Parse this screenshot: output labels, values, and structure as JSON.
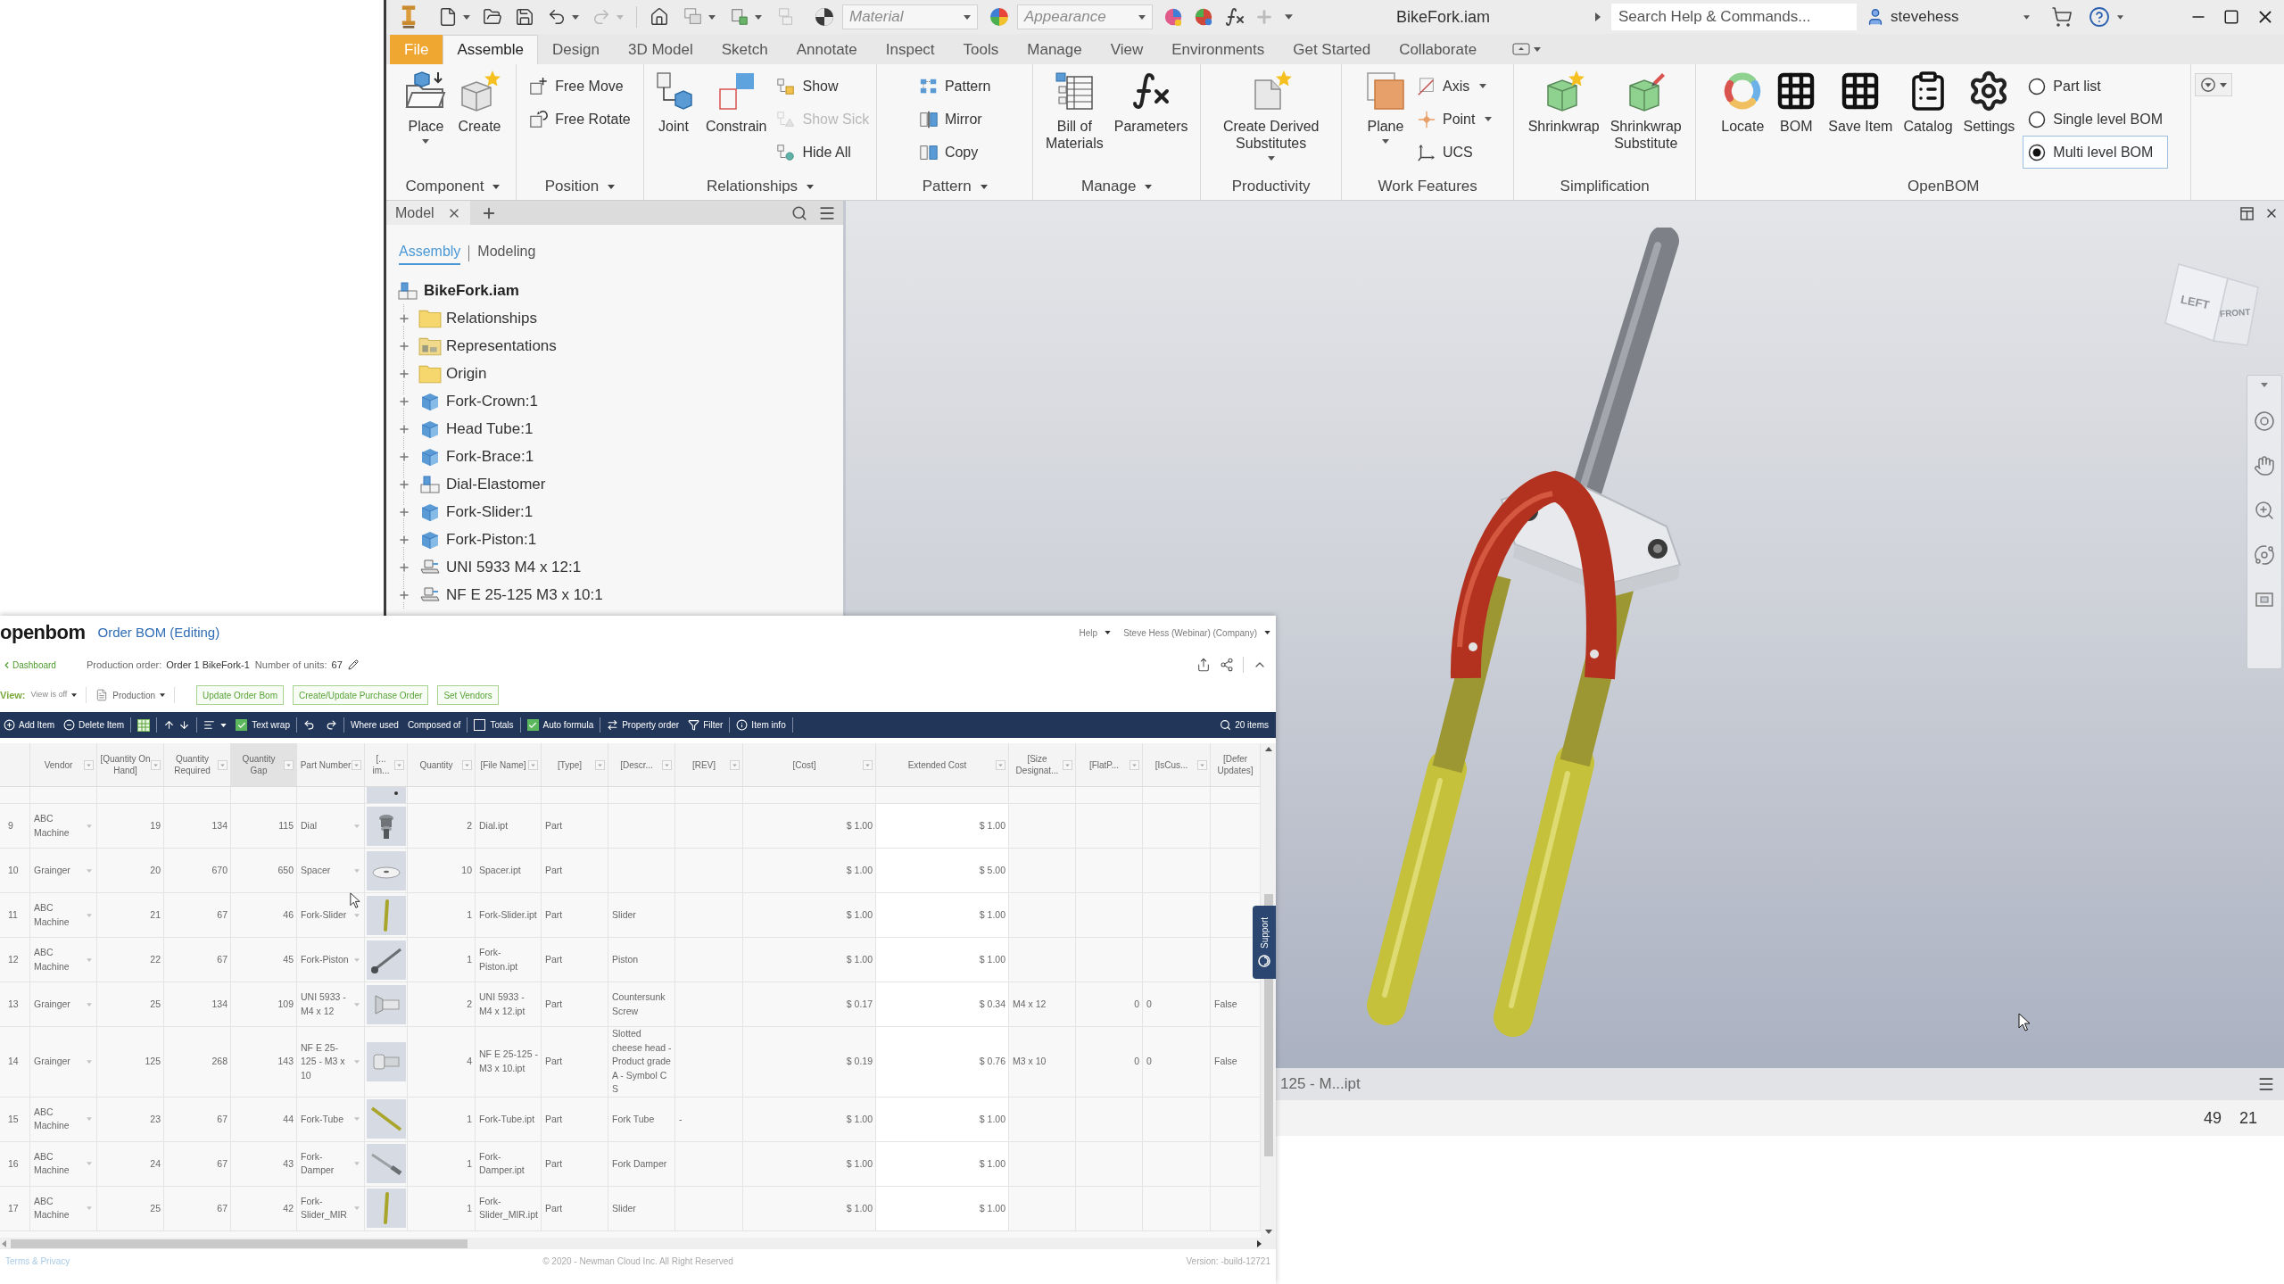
{
  "inventor": {
    "title_bar": {
      "material": "Material",
      "appearance": "Appearance",
      "document": "BikeFork.iam",
      "search": {
        "placeholder": "Search Help & Commands..."
      },
      "user": "stevehess"
    },
    "tabs": [
      {
        "label": "File",
        "kind": "file",
        "selected": false
      },
      {
        "label": "Assemble",
        "kind": "tab",
        "selected": true
      },
      {
        "label": "Design",
        "kind": "tab",
        "selected": false
      },
      {
        "label": "3D Model",
        "kind": "tab",
        "selected": false
      },
      {
        "label": "Sketch",
        "kind": "tab",
        "selected": false
      },
      {
        "label": "Annotate",
        "kind": "tab",
        "selected": false
      },
      {
        "label": "Inspect",
        "kind": "tab",
        "selected": false
      },
      {
        "label": "Tools",
        "kind": "tab",
        "selected": false
      },
      {
        "label": "Manage",
        "kind": "tab",
        "selected": false
      },
      {
        "label": "View",
        "kind": "tab",
        "selected": false
      },
      {
        "label": "Environments",
        "kind": "tab",
        "selected": false
      },
      {
        "label": "Get Started",
        "kind": "tab",
        "selected": false
      },
      {
        "label": "Collaborate",
        "kind": "tab",
        "selected": false
      }
    ],
    "ribbon": [
      {
        "label": "Component",
        "menu": true,
        "tools": [
          {
            "kind": "large",
            "label": "Place",
            "menu": true,
            "disabled": false
          },
          {
            "kind": "large",
            "label": "Create",
            "menu": false,
            "disabled": false
          }
        ]
      },
      {
        "label": "Position",
        "menu": true,
        "tools": [
          {
            "kind": "small",
            "label": "Free Move",
            "menu": false,
            "disabled": false
          },
          {
            "kind": "small",
            "label": "Free Rotate",
            "menu": false,
            "disabled": false
          }
        ]
      },
      {
        "label": "Relationships",
        "menu": true,
        "tools": [
          {
            "kind": "large",
            "label": "Joint",
            "menu": false,
            "disabled": false
          },
          {
            "kind": "large",
            "label": "Constrain",
            "menu": false,
            "disabled": false
          },
          {
            "kind": "small",
            "label": "Show",
            "menu": false,
            "disabled": false
          },
          {
            "kind": "small",
            "label": "Show Sick",
            "menu": false,
            "disabled": true
          },
          {
            "kind": "small",
            "label": "Hide All",
            "menu": false,
            "disabled": false
          }
        ]
      },
      {
        "label": "Pattern",
        "menu": true,
        "tools": [
          {
            "kind": "small",
            "label": "Pattern",
            "menu": false,
            "disabled": false
          },
          {
            "kind": "small",
            "label": "Mirror",
            "menu": false,
            "disabled": false
          },
          {
            "kind": "small",
            "label": "Copy",
            "menu": false,
            "disabled": false
          }
        ]
      },
      {
        "label": "Manage",
        "menu": true,
        "tools": [
          {
            "kind": "large",
            "label": "Bill of\nMaterials",
            "menu": false,
            "disabled": false
          },
          {
            "kind": "large",
            "label": "Parameters",
            "menu": false,
            "disabled": false
          }
        ]
      },
      {
        "label": "Productivity",
        "menu": false,
        "tools": [
          {
            "kind": "large",
            "label": "Create Derived\nSubstitutes",
            "menu": true,
            "disabled": false
          }
        ]
      },
      {
        "label": "Work Features",
        "menu": false,
        "tools": [
          {
            "kind": "large",
            "label": "Plane",
            "menu": true,
            "disabled": false
          },
          {
            "kind": "small",
            "label": "Axis",
            "menu": true,
            "disabled": false
          },
          {
            "kind": "small",
            "label": "Point",
            "menu": true,
            "disabled": false
          },
          {
            "kind": "small",
            "label": "UCS",
            "menu": false,
            "disabled": false
          }
        ]
      },
      {
        "label": "Simplification",
        "menu": false,
        "tools": [
          {
            "kind": "large",
            "label": "Shrinkwrap",
            "menu": false,
            "disabled": false
          },
          {
            "kind": "large",
            "label": "Shrinkwrap\nSubstitute",
            "menu": false,
            "disabled": false
          }
        ]
      },
      {
        "label": "OpenBOM",
        "menu": false,
        "tools": [
          {
            "kind": "large",
            "label": "Locate",
            "menu": false,
            "disabled": false
          },
          {
            "kind": "large",
            "label": "BOM",
            "menu": false,
            "disabled": false
          },
          {
            "kind": "large",
            "label": "Save Item",
            "menu": false,
            "disabled": false
          },
          {
            "kind": "large",
            "label": "Catalog",
            "menu": false,
            "disabled": false
          },
          {
            "kind": "large",
            "label": "Settings",
            "menu": false,
            "disabled": false
          }
        ],
        "options": [
          {
            "label": "Part list",
            "selected": false
          },
          {
            "label": "Single level BOM",
            "selected": false
          },
          {
            "label": "Multi level BOM",
            "selected": true
          }
        ]
      }
    ],
    "browser": {
      "tab": "Model",
      "modes": [
        {
          "label": "Assembly",
          "selected": true
        },
        {
          "label": "Modeling",
          "selected": false
        }
      ],
      "root": {
        "label": "BikeFork.iam",
        "children": [
          {
            "label": "Relationships",
            "kind": "folder",
            "expanded": false
          },
          {
            "label": "Representations",
            "kind": "representations",
            "expanded": false
          },
          {
            "label": "Origin",
            "kind": "folder",
            "expanded": false
          },
          {
            "label": "Fork-Crown:1",
            "kind": "part",
            "expanded": false
          },
          {
            "label": "Head Tube:1",
            "kind": "part",
            "expanded": false
          },
          {
            "label": "Fork-Brace:1",
            "kind": "part",
            "expanded": false
          },
          {
            "label": "Dial-Elastomer",
            "kind": "assembly",
            "expanded": false
          },
          {
            "label": "Fork-Slider:1",
            "kind": "part",
            "expanded": false
          },
          {
            "label": "Fork-Piston:1",
            "kind": "part",
            "expanded": false
          },
          {
            "label": "UNI 5933 M4 x 12:1",
            "kind": "fastener",
            "expanded": false
          },
          {
            "label": "NF E 25-125 M3 x 10:1",
            "kind": "fastener",
            "expanded": false
          }
        ]
      }
    },
    "viewport": {
      "view_cube": {
        "faces": [
          "LEFT",
          "FRONT"
        ]
      }
    },
    "document_tab": "125 - M...ipt",
    "status_bar": [
      "49",
      "21"
    ]
  },
  "openbom": {
    "logo": "openbom",
    "title": "Order BOM (Editing)",
    "help": "Help",
    "account": "Steve Hess (Webinar) (Company)",
    "back_link": "Dashboard",
    "order_label": "Production order:",
    "order": "Order 1 BikeFork-1",
    "units_label": "Number of units:",
    "units": "67",
    "view_label": "View:",
    "view": "View is off",
    "layout": "Production",
    "actions": [
      "Update Order Bom",
      "Create/Update Purchase Order",
      "Set Vendors"
    ],
    "toolbar": {
      "add": "Add Item",
      "delete": "Delete Item",
      "text_wrap": {
        "label": "Text wrap",
        "checked": true
      },
      "where_used": "Where used",
      "composed_of": "Composed of",
      "totals": {
        "label": "Totals",
        "checked": false
      },
      "auto_formula": {
        "label": "Auto formula",
        "checked": true
      },
      "property_order": "Property order",
      "filter": "Filter",
      "item_info": "Item info",
      "count": "20 items"
    },
    "columns": [
      {
        "label": "Vendor",
        "kind": "select",
        "filter": true,
        "selected": false
      },
      {
        "label": "[Quantity On Hand]",
        "kind": "number",
        "filter": true,
        "selected": false
      },
      {
        "label": "Quantity Required",
        "kind": "number",
        "filter": true,
        "selected": false
      },
      {
        "label": "Quantity Gap",
        "kind": "number",
        "filter": true,
        "selected": true
      },
      {
        "label": "Part Number",
        "kind": "select",
        "filter": true,
        "selected": false
      },
      {
        "label": "[... im...",
        "kind": "image",
        "filter": true,
        "selected": false
      },
      {
        "label": "Quantity",
        "kind": "number",
        "filter": true,
        "selected": false
      },
      {
        "label": "[File Name]",
        "kind": "text",
        "filter": true,
        "selected": false
      },
      {
        "label": "[Type]",
        "kind": "text",
        "filter": true,
        "selected": false
      },
      {
        "label": "[Descr...",
        "kind": "text",
        "filter": true,
        "selected": false
      },
      {
        "label": "[REV]",
        "kind": "text",
        "filter": true,
        "selected": false
      },
      {
        "label": "[Cost]",
        "kind": "number",
        "filter": true,
        "selected": false
      },
      {
        "label": "Extended Cost",
        "kind": "computed",
        "filter": true,
        "selected": false
      },
      {
        "label": "[Size Designat...",
        "kind": "text",
        "filter": true,
        "selected": false
      },
      {
        "label": "[FlatP...",
        "kind": "number",
        "filter": true,
        "selected": false
      },
      {
        "label": "[IsCus...",
        "kind": "text",
        "filter": true,
        "selected": false
      },
      {
        "label": "[Defer Updates]",
        "kind": "text",
        "filter": false,
        "selected": false
      }
    ],
    "rows": [
      {
        "row": "9",
        "vendor": "ABC Machine",
        "quantity_on_hand": "19",
        "quantity_required": "134",
        "quantity_gap": "115",
        "part_number": "Dial",
        "quantity": "2",
        "file_name": "Dial.ipt",
        "type": "Part",
        "cost": "$ 1.00",
        "extended_cost": "$ 1.00"
      },
      {
        "row": "10",
        "vendor": "Grainger",
        "quantity_on_hand": "20",
        "quantity_required": "670",
        "quantity_gap": "650",
        "part_number": "Spacer",
        "quantity": "10",
        "file_name": "Spacer.ipt",
        "type": "Part",
        "cost": "$ 1.00",
        "extended_cost": "$ 5.00"
      },
      {
        "row": "11",
        "vendor": "ABC Machine",
        "quantity_on_hand": "21",
        "quantity_required": "67",
        "quantity_gap": "46",
        "part_number": "Fork-Slider",
        "quantity": "1",
        "file_name": "Fork-Slider.ipt",
        "type": "Part",
        "descr": "Slider",
        "cost": "$ 1.00",
        "extended_cost": "$ 1.00"
      },
      {
        "row": "12",
        "vendor": "ABC Machine",
        "quantity_on_hand": "22",
        "quantity_required": "67",
        "quantity_gap": "45",
        "part_number": "Fork-Piston",
        "quantity": "1",
        "file_name": "Fork-Piston.ipt",
        "type": "Part",
        "descr": "Piston",
        "cost": "$ 1.00",
        "extended_cost": "$ 1.00"
      },
      {
        "row": "13",
        "vendor": "Grainger",
        "quantity_on_hand": "25",
        "quantity_required": "134",
        "quantity_gap": "109",
        "part_number": "UNI 5933 - M4 x 12",
        "quantity": "2",
        "file_name": "UNI 5933 - M4 x 12.ipt",
        "type": "Part",
        "descr": "Countersunk Screw",
        "cost": "$ 0.17",
        "extended_cost": "$ 0.34",
        "size_designat": "M4 x 12",
        "flatp": "0",
        "iscus": "0",
        "defer_updates": "False"
      },
      {
        "row": "14",
        "vendor": "Grainger",
        "quantity_on_hand": "125",
        "quantity_required": "268",
        "quantity_gap": "143",
        "part_number": "NF E 25-125 - M3 x 10",
        "quantity": "4",
        "file_name": "NF E 25-125 - M3 x 10.ipt",
        "type": "Part",
        "descr": "Slotted cheese head - Product grade A - Symbol C S",
        "cost": "$ 0.19",
        "extended_cost": "$ 0.76",
        "size_designat": "M3 x 10",
        "flatp": "0",
        "iscus": "0",
        "defer_updates": "False"
      },
      {
        "row": "15",
        "vendor": "ABC Machine",
        "quantity_on_hand": "23",
        "quantity_required": "67",
        "quantity_gap": "44",
        "part_number": "Fork-Tube",
        "quantity": "1",
        "file_name": "Fork-Tube.ipt",
        "type": "Part",
        "descr": "Fork Tube",
        "rev": "-",
        "cost": "$ 1.00",
        "extended_cost": "$ 1.00"
      },
      {
        "row": "16",
        "vendor": "ABC Machine",
        "quantity_on_hand": "24",
        "quantity_required": "67",
        "quantity_gap": "43",
        "part_number": "Fork-Damper",
        "quantity": "1",
        "file_name": "Fork-Damper.ipt",
        "type": "Part",
        "descr": "Fork Damper",
        "cost": "$ 1.00",
        "extended_cost": "$ 1.00"
      },
      {
        "row": "17",
        "vendor": "ABC Machine",
        "quantity_on_hand": "25",
        "quantity_required": "67",
        "quantity_gap": "42",
        "part_number": "Fork-Slider_MIR",
        "quantity": "1",
        "file_name": "Fork-Slider_MIR.ipt",
        "type": "Part",
        "descr": "Slider",
        "cost": "$ 1.00",
        "extended_cost": "$ 1.00"
      }
    ],
    "support": "Support",
    "footer": {
      "terms": "Terms & Privacy",
      "copyright": "© 2020 - Newman Cloud Inc. All Right Reserved",
      "version": "Version: -build-12721"
    }
  }
}
